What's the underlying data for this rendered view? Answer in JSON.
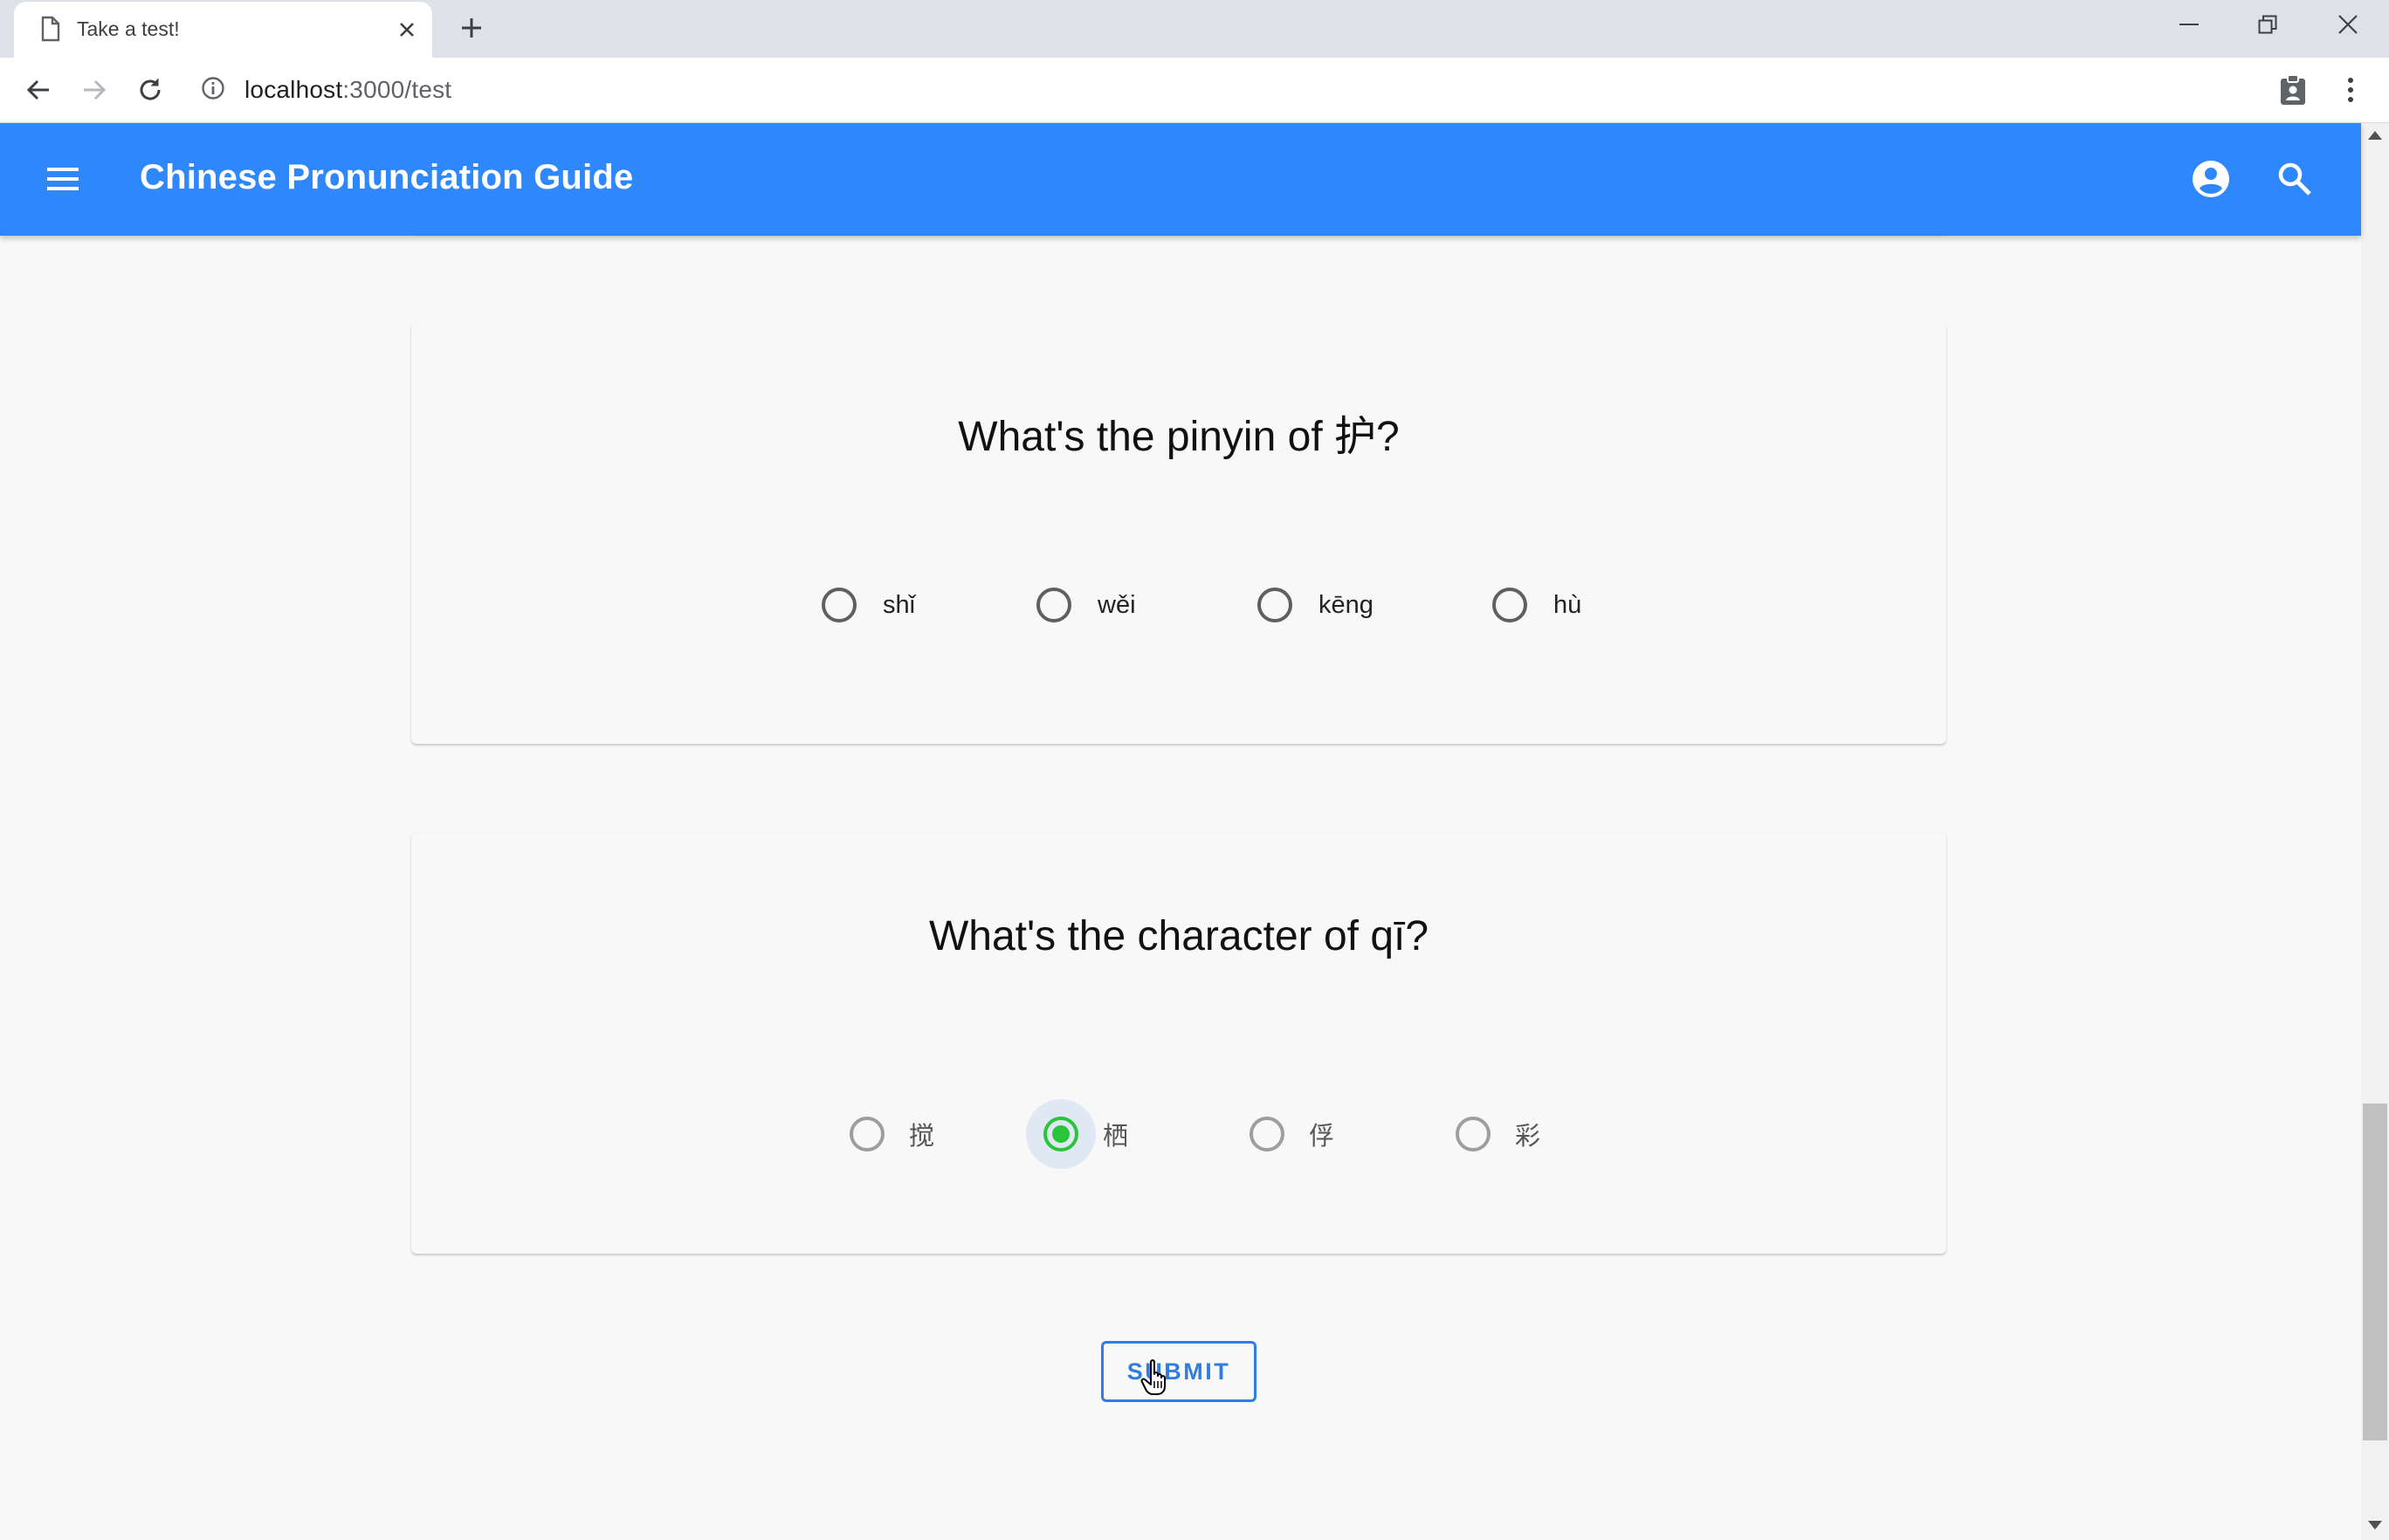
{
  "browser": {
    "tab_title": "Take a test!",
    "url_host": "localhost",
    "url_path": ":3000/test"
  },
  "appbar": {
    "title": "Chinese Pronunciation Guide"
  },
  "questions": [
    {
      "prompt": "What's the pinyin of 护?",
      "options": [
        "shǐ",
        "wěi",
        "kēng",
        "hù"
      ],
      "selected": null
    },
    {
      "prompt": "What's the character of qī?",
      "options": [
        "搅",
        "栖",
        "俘",
        "彩"
      ],
      "selected": "栖"
    }
  ],
  "submit_label": "SUBMIT",
  "colors": {
    "appbar": "#2f87fc",
    "selected_radio": "#2ac43a",
    "button": "#2f7de1"
  }
}
